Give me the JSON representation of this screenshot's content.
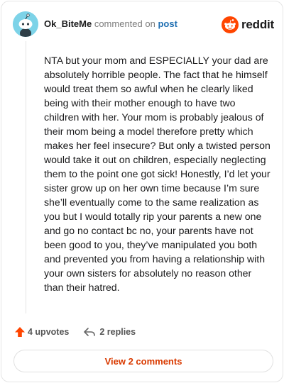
{
  "header": {
    "username": "Ok_BiteMe",
    "action_text": "commented on",
    "post_link": "post",
    "logo_text": "reddit"
  },
  "comment": {
    "body": "NTA but your mom and ESPECIALLY your dad are absolutely horrible people. The fact that he himself would treat them so awful when he clearly liked being with their mother enough to have two children with her. Your mom is probably jealous of their mom being a model therefore pretty which makes her feel insecure? But only a twisted person would take it out on children, especially neglecting them to the point one got sick! Honestly, I’d let your sister grow up on her own time because I’m sure she’ll eventually come to the same realization as you but I would totally rip your parents a new one and go no contact bc no, your parents have not been good to you, they’ve manipulated you both and prevented you from having a relationship with your own sisters for absolutely no reason other than their hatred."
  },
  "footer": {
    "upvotes": "4 upvotes",
    "replies": "2 replies",
    "view_button": "View 2 comments"
  },
  "colors": {
    "accent": "#ff4500",
    "link": "#1f6fb2",
    "view_button_text": "#d93a00",
    "avatar_bg": "#7dd3e8"
  },
  "icons": {
    "avatar": "snoo-avatar-icon",
    "logo": "reddit-logo-icon",
    "upvote": "upvote-arrow-icon",
    "reply": "reply-arrow-icon"
  }
}
